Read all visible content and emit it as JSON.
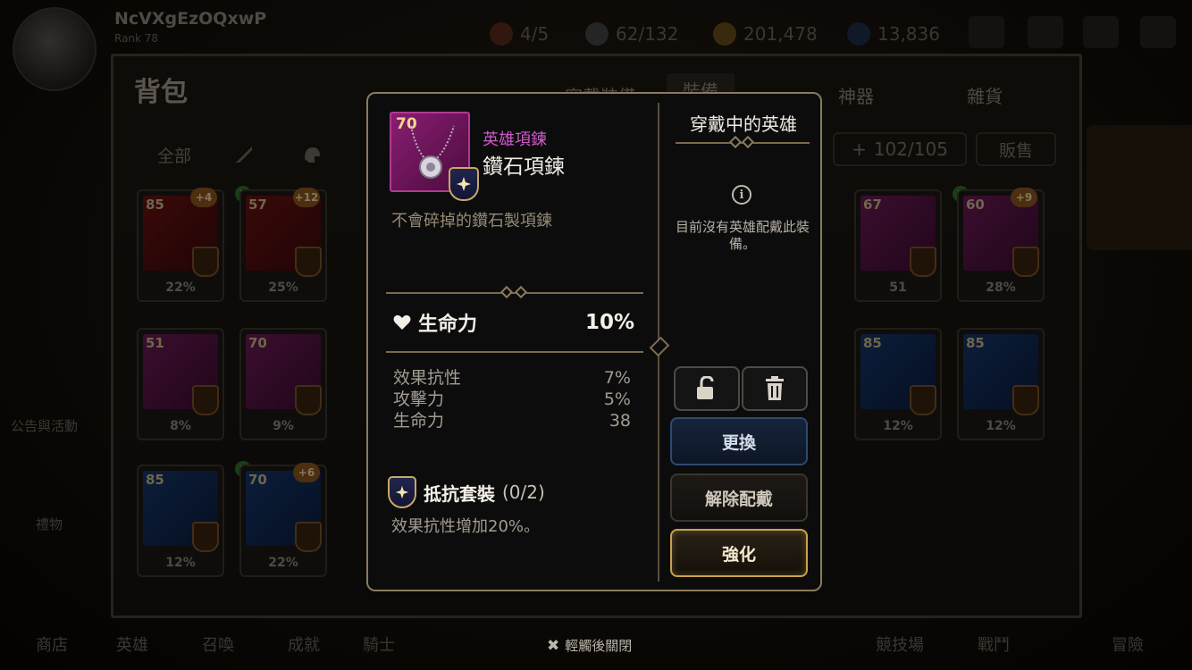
{
  "background": {
    "player_name": "NcVXgEzOQxwP",
    "player_sub": "Rank 78",
    "resources": [
      {
        "name": "stamina",
        "icon": "stamina-icon",
        "value": "4/5"
      },
      {
        "name": "energy",
        "icon": "energy-icon",
        "value": "62/132"
      },
      {
        "name": "gold",
        "icon": "gold-coin-icon",
        "value": "201,478"
      },
      {
        "name": "crystal",
        "icon": "crystal-icon",
        "value": "13,836"
      }
    ],
    "inventory_title": "背包",
    "tabs": [
      "穿戴裝備",
      "裝備",
      "神器",
      "雜貨"
    ],
    "filter_all": "全部",
    "capacity": "102/105",
    "sell_label": "販售",
    "left_nav": [
      "公告與活動",
      "禮物"
    ],
    "bottom_nav": [
      "商店",
      "英雄",
      "召喚",
      "成就",
      "騎士",
      "競技場",
      "戰鬥",
      "冒險"
    ],
    "cards": [
      {
        "level": "85",
        "plus": "+4",
        "stat": "22%",
        "color": "red"
      },
      {
        "level": "57",
        "plus": "+12",
        "stat": "25%",
        "color": "red"
      },
      {
        "level": "67",
        "plus": "",
        "stat": "51",
        "color": "purple"
      },
      {
        "level": "60",
        "plus": "+9",
        "stat": "28%",
        "color": "purple"
      },
      {
        "level": "51",
        "plus": "",
        "stat": "8%",
        "color": "purple"
      },
      {
        "level": "70",
        "plus": "",
        "stat": "9%",
        "color": "purple"
      },
      {
        "level": "85",
        "plus": "",
        "stat": "12%",
        "color": "blue"
      },
      {
        "level": "85",
        "plus": "",
        "stat": "12%",
        "color": "blue"
      },
      {
        "level": "85",
        "plus": "",
        "stat": "12%",
        "color": "blue"
      },
      {
        "level": "70",
        "plus": "+6",
        "stat": "22%",
        "color": "blue"
      }
    ]
  },
  "modal": {
    "item": {
      "level": "70",
      "rarity": "英雄項鍊",
      "name": "鑽石項鍊",
      "description": "不會碎掉的鑽石製項鍊"
    },
    "main_stat": {
      "name": "生命力",
      "value": "10%"
    },
    "sub_stats": [
      {
        "name": "效果抗性",
        "value": "7%"
      },
      {
        "name": "攻擊力",
        "value": "5%"
      },
      {
        "name": "生命力",
        "value": "38"
      }
    ],
    "set": {
      "name": "抵抗套裝",
      "count": "(0/2)",
      "effect": "效果抗性增加20%。"
    },
    "wearing": {
      "title": "穿戴中的英雄",
      "empty_text": "目前沒有英雄配戴此裝備。"
    },
    "buttons": {
      "swap": "更換",
      "unequip": "解除配戴",
      "enhance": "強化"
    }
  },
  "close_hint": "輕觸後關閉",
  "colors": {
    "rarity_hero": "#d05ac9",
    "gold_border": "#c8a14e"
  }
}
